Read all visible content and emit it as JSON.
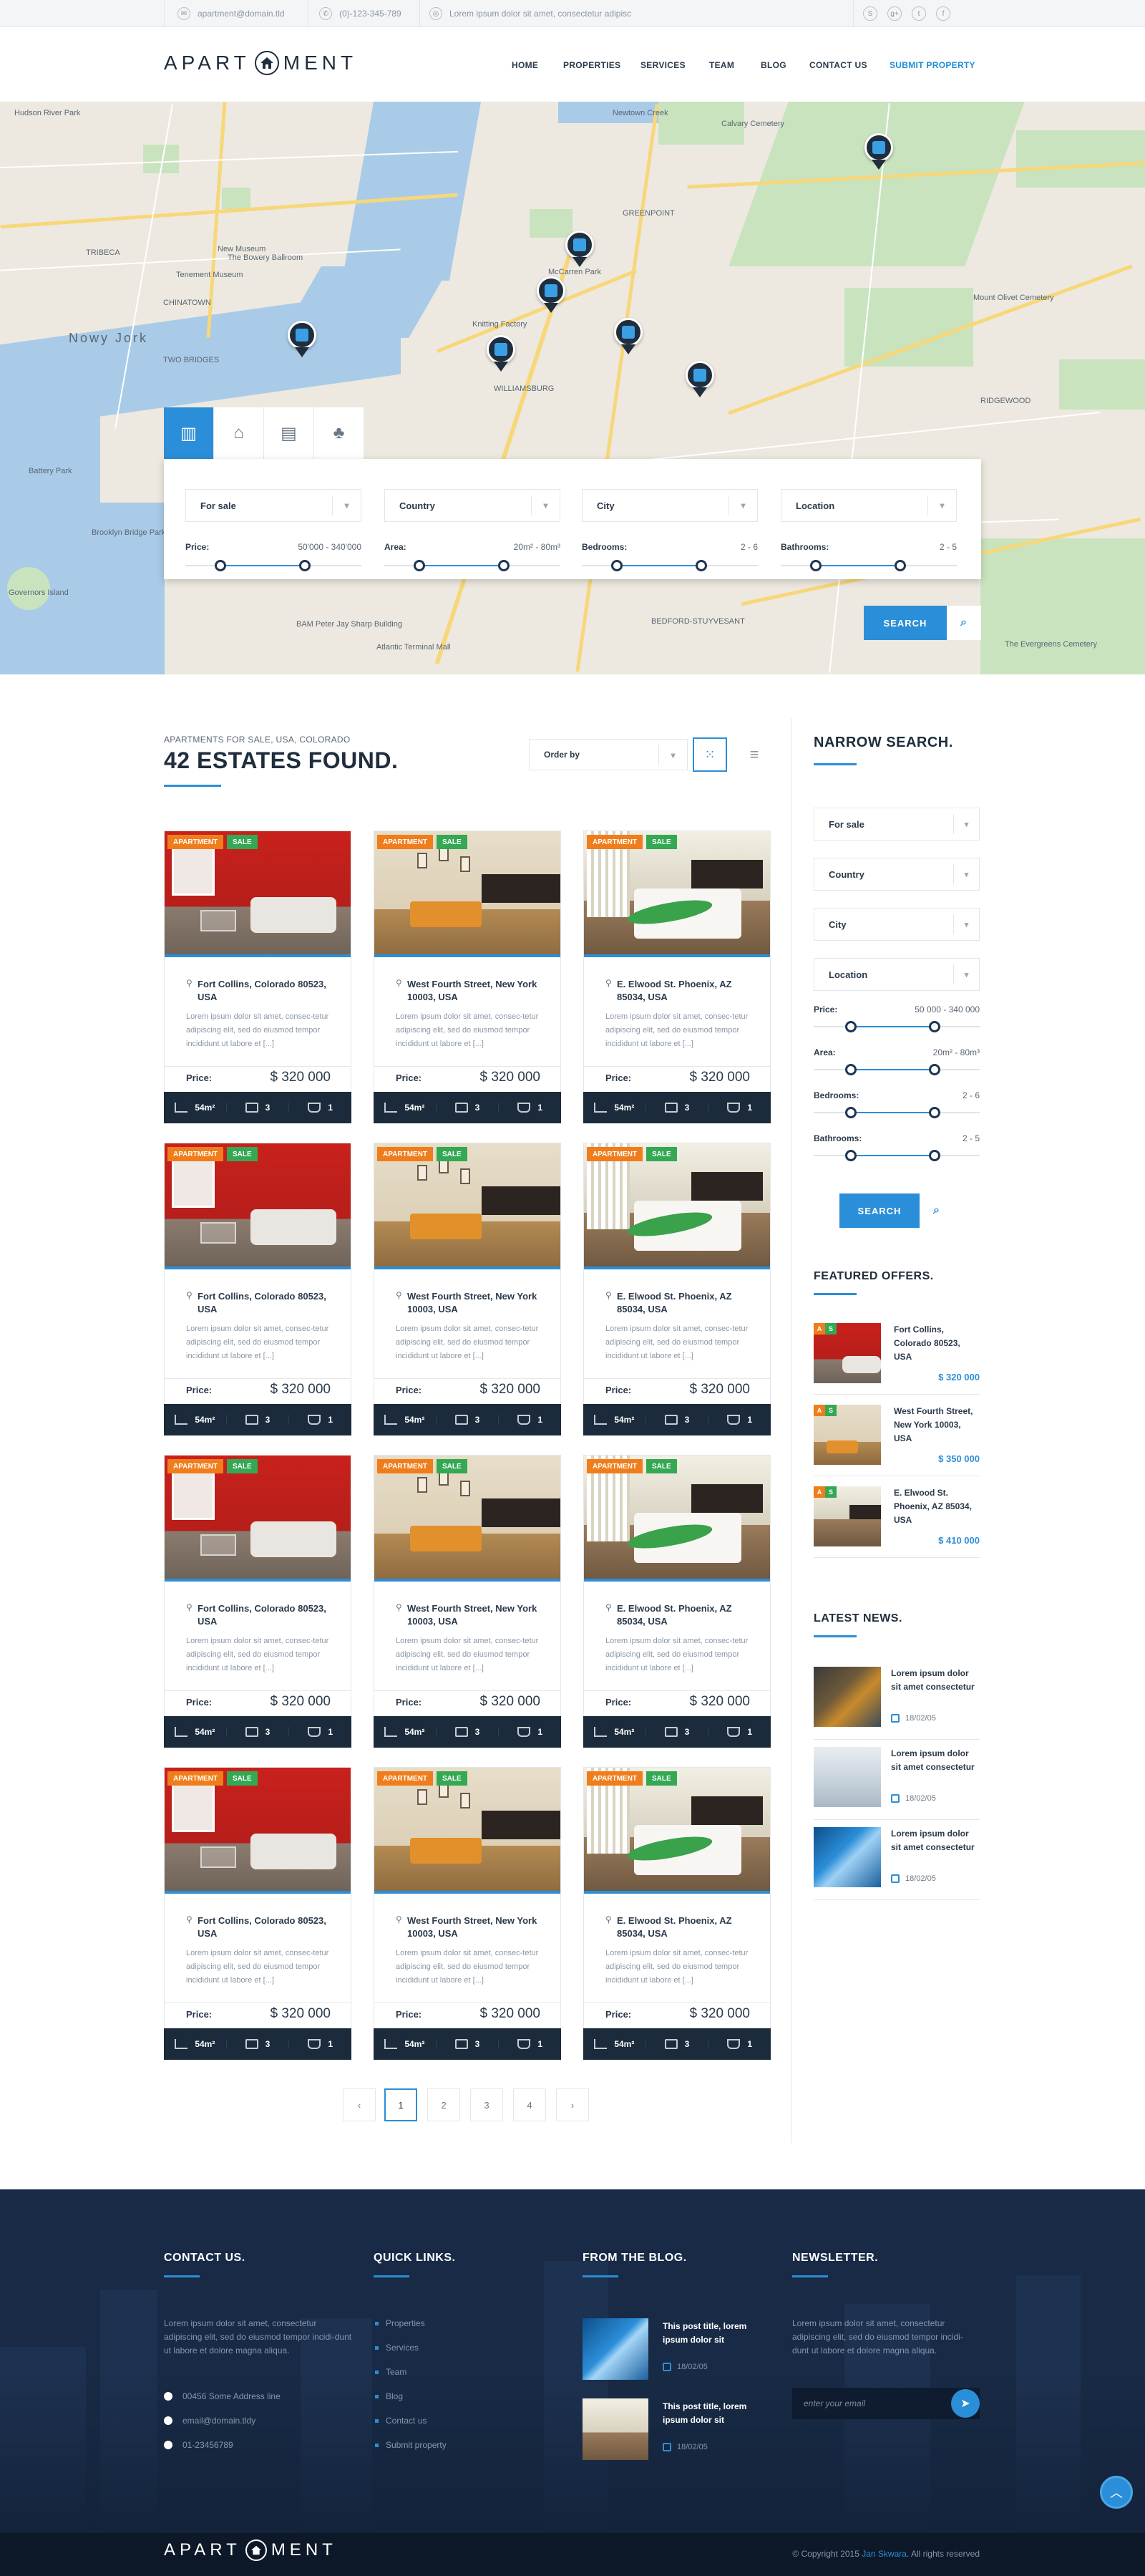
{
  "topbar": {
    "email": "apartment@domain.tld",
    "phone": "(0)-123-345-789",
    "tagline": "Lorem ipsum dolor sit amet, consectetur adipisc",
    "social": [
      "skype-icon",
      "google-plus-icon",
      "twitter-icon",
      "facebook-icon"
    ]
  },
  "header": {
    "logo_left": "APART",
    "logo_right": "MENT",
    "nav": [
      "HOME",
      "PROPERTIES",
      "SERVICES",
      "TEAM",
      "BLOG",
      "CONTACT US",
      "SUBMIT PROPERTY"
    ]
  },
  "map": {
    "labels": [
      "New Museum",
      "The Bowery Ballroom",
      "Tenement Museum",
      "CHINATOWN",
      "TWO BRIDGES",
      "TRIBECA",
      "Nowy Jork",
      "Battery Park",
      "Hudson River Park",
      "WILLIAMSBURG",
      "McCarren Park",
      "Knitting Factory",
      "GREENPOINT",
      "Newtown Creek",
      "Calvary Cemetery",
      "Mount Olivet Cemetery",
      "RIDGEWOOD",
      "BEDFORD-STUYVESANT",
      "BAM Peter Jay Sharp Building",
      "Atlantic Terminal Mall",
      "Governors Island",
      "Brooklyn Bridge Park",
      "The Evergreens Cemetery"
    ],
    "colors": {
      "water": "#a9cbe8",
      "park": "#c9e3bf",
      "land": "#ede9e0",
      "road": "#f7d779"
    }
  },
  "search": {
    "tabs": [
      "apartment-icon",
      "house-icon",
      "office-icon",
      "land-icon"
    ],
    "selects": [
      "For sale",
      "Country",
      "City",
      "Location"
    ],
    "ranges": [
      {
        "label": "Price:",
        "value": "50'000 - 340'000",
        "from": 0.2,
        "to": 0.68
      },
      {
        "label": "Area:",
        "value": "20m² - 80m³",
        "from": 0.2,
        "to": 0.68
      },
      {
        "label": "Bedrooms:",
        "value": "2 - 6",
        "from": 0.2,
        "to": 0.68
      },
      {
        "label": "Bathrooms:",
        "value": "2 - 5",
        "from": 0.2,
        "to": 0.68
      }
    ],
    "button": "SEARCH"
  },
  "listing": {
    "breadcrumb": "APARTMENTS FOR SALE, USA, COLORADO",
    "title": "42 ESTATES FOUND.",
    "order_by": "Order by",
    "cards": [
      {
        "type": "APARTMENT",
        "status": "SALE",
        "address": "Fort Collins, Colorado 80523, USA",
        "desc": "Lorem ipsum dolor sit amet, consec-tetur adipiscing elit, sed do eiusmod tempor incididunt ut labore et [...]",
        "price_label": "Price:",
        "price": "$ 320 000",
        "area": "54m²",
        "rooms": "3",
        "baths": "1",
        "img": "room1"
      },
      {
        "type": "APARTMENT",
        "status": "SALE",
        "address": "West Fourth Street, New York 10003, USA",
        "desc": "Lorem ipsum dolor sit amet, consec-tetur adipiscing elit, sed do eiusmod tempor incididunt ut labore et [...]",
        "price_label": "Price:",
        "price": "$ 320 000",
        "area": "54m²",
        "rooms": "3",
        "baths": "1",
        "img": "room2"
      },
      {
        "type": "APARTMENT",
        "status": "SALE",
        "address": "E. Elwood St. Phoenix, AZ 85034, USA",
        "desc": "Lorem ipsum dolor sit amet, consec-tetur adipiscing elit, sed do eiusmod tempor incididunt ut labore et [...]",
        "price_label": "Price:",
        "price": "$ 320 000",
        "area": "54m²",
        "rooms": "3",
        "baths": "1",
        "img": "room3"
      }
    ],
    "pagination": [
      "‹",
      "1",
      "2",
      "3",
      "4",
      "›"
    ],
    "current_page": "1"
  },
  "sidebar": {
    "narrow_title": "NARROW SEARCH.",
    "selects": [
      "For sale",
      "Country",
      "City",
      "Location"
    ],
    "ranges": [
      {
        "label": "Price:",
        "value": "50 000 - 340 000"
      },
      {
        "label": "Area:",
        "value": "20m² - 80m³"
      },
      {
        "label": "Bedrooms:",
        "value": "2 - 6"
      },
      {
        "label": "Bathrooms:",
        "value": "2 - 5"
      }
    ],
    "search_button": "SEARCH",
    "featured_title": "FEATURED OFFERS.",
    "featured": [
      {
        "title": "Fort Collins, Colorado 80523, USA",
        "price": "$ 320 000"
      },
      {
        "title": "West Fourth Street, New York 10003, USA",
        "price": "$ 350 000"
      },
      {
        "title": "E. Elwood St. Phoenix, AZ 85034, USA",
        "price": "$ 410 000"
      }
    ],
    "news_title": "LATEST NEWS.",
    "news": [
      {
        "title": "Lorem ipsum dolor sit amet consectetur",
        "date": "18/02/05"
      },
      {
        "title": "Lorem ipsum dolor sit amet consectetur",
        "date": "18/02/05"
      },
      {
        "title": "Lorem ipsum dolor sit amet consectetur",
        "date": "18/02/05"
      }
    ]
  },
  "footer": {
    "contact_title": "CONTACT US.",
    "contact_text": "Lorem ipsum dolor sit amet, consectetur adipiscing elit, sed do eiusmod tempor incidi-dunt ut labore et dolore magna aliqua.",
    "address": "00456 Some Address line",
    "email": "email@domain.tldy",
    "phone": "01-23456789",
    "links_title": "QUICK LINKS.",
    "links": [
      "Properties",
      "Services",
      "Team",
      "Blog",
      "Contact us",
      "Submit property"
    ],
    "blog_title": "FROM THE BLOG.",
    "blog": [
      {
        "title": "This post title, lorem ipsum dolor sit",
        "date": "18/02/05"
      },
      {
        "title": "This post title, lorem ipsum dolor sit",
        "date": "18/02/05"
      }
    ],
    "newsletter_title": "NEWSLETTER.",
    "newsletter_text": "Lorem ipsum dolor sit amet, consectetur adipiscing elit, sed do eiusmod tempor incidi-dunt ut labore et dolore magna aliqua.",
    "newsletter_placeholder": "enter your email",
    "copyright_prefix": "© Copyright 2015",
    "copyright_name": "Jan Skwara",
    "copyright_suffix": ". All rights reserved"
  },
  "colors": {
    "accent": "#2b8ed8",
    "dark": "#1c2b3c",
    "orange": "#f07d1b",
    "green": "#34a853"
  }
}
